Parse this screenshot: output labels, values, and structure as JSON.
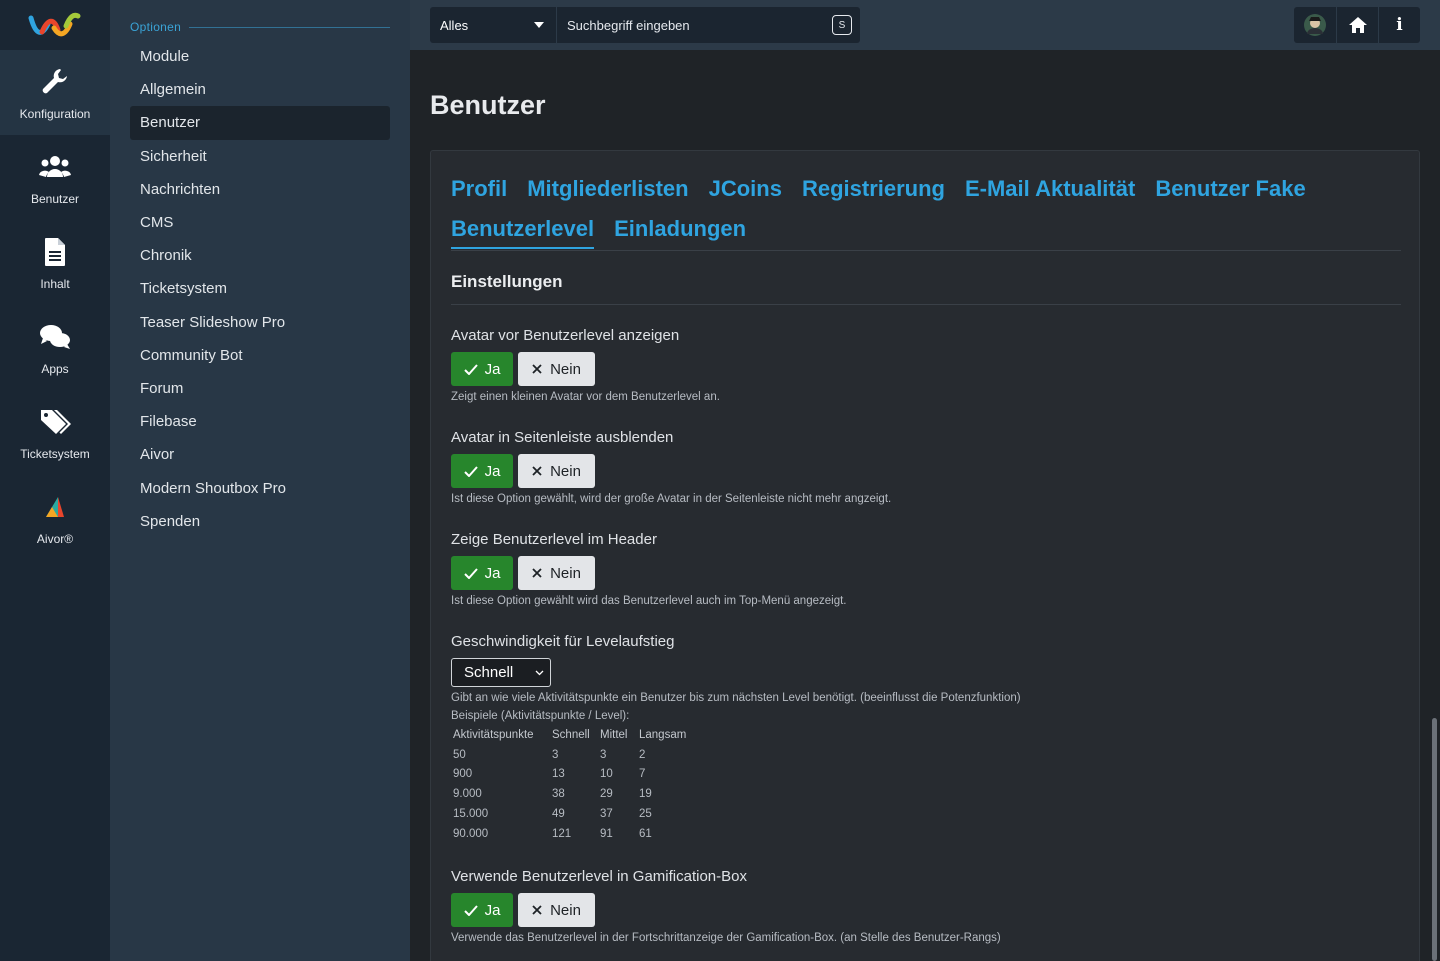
{
  "rail": {
    "items": [
      {
        "label": "Konfiguration",
        "icon": "wrench-icon",
        "active": true
      },
      {
        "label": "Benutzer",
        "icon": "users-icon",
        "active": false
      },
      {
        "label": "Inhalt",
        "icon": "document-icon",
        "active": false
      },
      {
        "label": "Apps",
        "icon": "chat-bubbles-icon",
        "active": false
      },
      {
        "label": "Ticketsystem",
        "icon": "tags-icon",
        "active": false
      },
      {
        "label": "Aivor®",
        "icon": "aivor-logo-icon",
        "active": false
      }
    ]
  },
  "sidebar": {
    "heading": "Optionen",
    "items": [
      "Module",
      "Allgemein",
      "Benutzer",
      "Sicherheit",
      "Nachrichten",
      "CMS",
      "Chronik",
      "Ticketsystem",
      "Teaser Slideshow Pro",
      "Community Bot",
      "Forum",
      "Filebase",
      "Aivor",
      "Modern Shoutbox Pro",
      "Spenden"
    ],
    "active_index": 2
  },
  "topbar": {
    "search_scope": "Alles",
    "search_placeholder": "Suchbegriff eingeben",
    "search_shortcut": "S",
    "info_label": "i"
  },
  "page": {
    "title": "Benutzer",
    "tabs": [
      "Profil",
      "Mitgliederlisten",
      "JCoins",
      "Registrierung",
      "E-Mail Aktualität",
      "Benutzer Fake",
      "Benutzerlevel",
      "Einladungen"
    ],
    "active_tab_index": 6,
    "section_title": "Einstellungen"
  },
  "options": {
    "yes_label": "Ja",
    "no_label": "Nein",
    "avatar_before_level": {
      "label": "Avatar vor Benutzerlevel anzeigen",
      "desc": "Zeigt einen kleinen Avatar vor dem Benutzerlevel an.",
      "value": "Ja"
    },
    "avatar_sidebar_hide": {
      "label": "Avatar in Seitenleiste ausblenden",
      "desc": "Ist diese Option gewählt, wird der große Avatar in der Seitenleiste nicht mehr angzeigt.",
      "value": "Ja"
    },
    "level_in_header": {
      "label": "Zeige Benutzerlevel im Header",
      "desc": "Ist diese Option gewählt wird das Benutzerlevel auch im Top-Menü angezeigt.",
      "value": "Ja"
    },
    "level_speed": {
      "label": "Geschwindigkeit für Levelaufstieg",
      "selected": "Schnell",
      "desc": "Gibt an wie viele Aktivitätspunkte ein Benutzer bis zum nächsten Level benötigt. (beeinflusst die Potenzfunktion)",
      "examples_title": "Beispiele (Aktivitätspunkte / Level):",
      "table": {
        "headers": [
          "Aktivitätspunkte",
          "Schnell",
          "Mittel",
          "Langsam"
        ],
        "rows": [
          [
            "50",
            "3",
            "3",
            "2"
          ],
          [
            "900",
            "13",
            "10",
            "7"
          ],
          [
            "9.000",
            "38",
            "29",
            "19"
          ],
          [
            "15.000",
            "49",
            "37",
            "25"
          ],
          [
            "90.000",
            "121",
            "91",
            "61"
          ]
        ]
      }
    },
    "gamification_box": {
      "label": "Verwende Benutzerlevel in Gamification-Box",
      "desc": "Verwende das Benutzerlevel in der Fortschrittanzeige der Gamification-Box. (an Stelle des Benutzer-Rangs)",
      "value": "Ja"
    }
  },
  "colors": {
    "accent": "#2fa4e0",
    "yes_green": "#27862c",
    "rail_bg": "#1a2633",
    "sidebar_bg": "#283746"
  }
}
